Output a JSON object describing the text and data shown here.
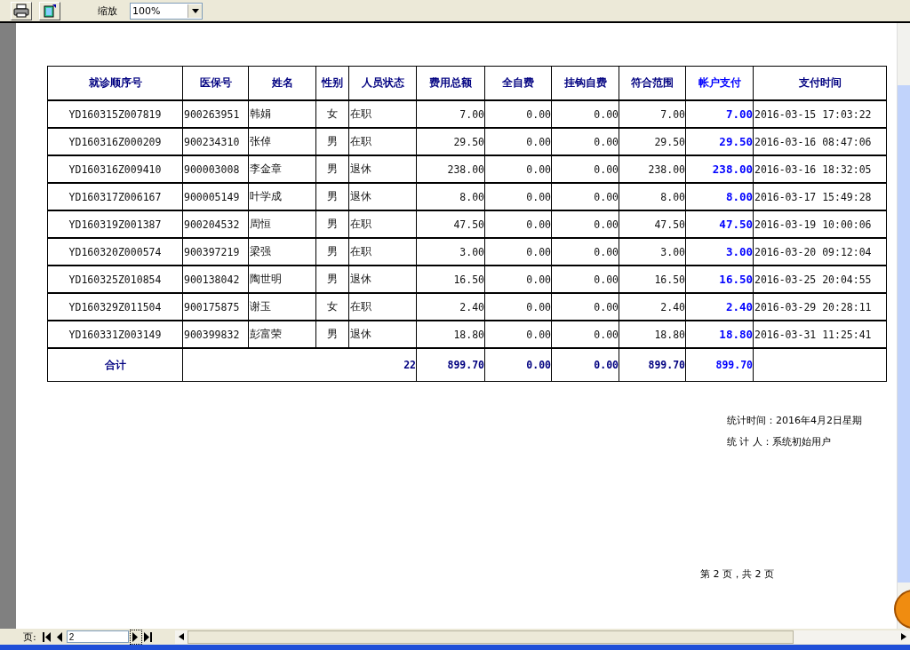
{
  "toolbar": {
    "zoom_label": "缩放",
    "zoom_value": "100%"
  },
  "table": {
    "columns": [
      {
        "label": "就诊顺序号",
        "highlighted": false
      },
      {
        "label": "医保号",
        "highlighted": false
      },
      {
        "label": "姓名",
        "highlighted": false
      },
      {
        "label": "性别",
        "highlighted": false
      },
      {
        "label": "人员状态",
        "highlighted": false
      },
      {
        "label": "费用总额",
        "highlighted": false
      },
      {
        "label": "全自费",
        "highlighted": false
      },
      {
        "label": "挂钩自费",
        "highlighted": false
      },
      {
        "label": "符合范围",
        "highlighted": false
      },
      {
        "label": "帐户支付",
        "highlighted": true
      },
      {
        "label": "支付时间",
        "highlighted": false
      }
    ],
    "rows": [
      [
        "YD160315Z007819",
        "900263951",
        "韩娟",
        "女",
        "在职",
        "7.00",
        "0.00",
        "0.00",
        "7.00",
        "7.00",
        "2016-03-15 17:03:22"
      ],
      [
        "YD160316Z000209",
        "900234310",
        "张倬",
        "男",
        "在职",
        "29.50",
        "0.00",
        "0.00",
        "29.50",
        "29.50",
        "2016-03-16 08:47:06"
      ],
      [
        "YD160316Z009410",
        "900003008",
        "李金章",
        "男",
        "退休",
        "238.00",
        "0.00",
        "0.00",
        "238.00",
        "238.00",
        "2016-03-16 18:32:05"
      ],
      [
        "YD160317Z006167",
        "900005149",
        "叶学成",
        "男",
        "退休",
        "8.00",
        "0.00",
        "0.00",
        "8.00",
        "8.00",
        "2016-03-17 15:49:28"
      ],
      [
        "YD160319Z001387",
        "900204532",
        "周恒",
        "男",
        "在职",
        "47.50",
        "0.00",
        "0.00",
        "47.50",
        "47.50",
        "2016-03-19 10:00:06"
      ],
      [
        "YD160320Z000574",
        "900397219",
        "梁强",
        "男",
        "在职",
        "3.00",
        "0.00",
        "0.00",
        "3.00",
        "3.00",
        "2016-03-20 09:12:04"
      ],
      [
        "YD160325Z010854",
        "900138042",
        "陶世明",
        "男",
        "退休",
        "16.50",
        "0.00",
        "0.00",
        "16.50",
        "16.50",
        "2016-03-25 20:04:55"
      ],
      [
        "YD160329Z011504",
        "900175875",
        "谢玉",
        "女",
        "在职",
        "2.40",
        "0.00",
        "0.00",
        "2.40",
        "2.40",
        "2016-03-29 20:28:11"
      ],
      [
        "YD160331Z003149",
        "900399832",
        "彭富荣",
        "男",
        "退休",
        "18.80",
        "0.00",
        "0.00",
        "18.80",
        "18.80",
        "2016-03-31 11:25:41"
      ]
    ],
    "total": {
      "label": "合计",
      "count": "22",
      "sums": [
        "899.70",
        "0.00",
        "0.00",
        "899.70",
        "899.70"
      ]
    }
  },
  "footer": {
    "stat_time": "统计时间：2016年4月2日星期",
    "stat_person": "统 计 人：系统初始用户",
    "page_info": "第 2 页，共 2 页"
  },
  "pager": {
    "label": "页:",
    "page": "2"
  }
}
